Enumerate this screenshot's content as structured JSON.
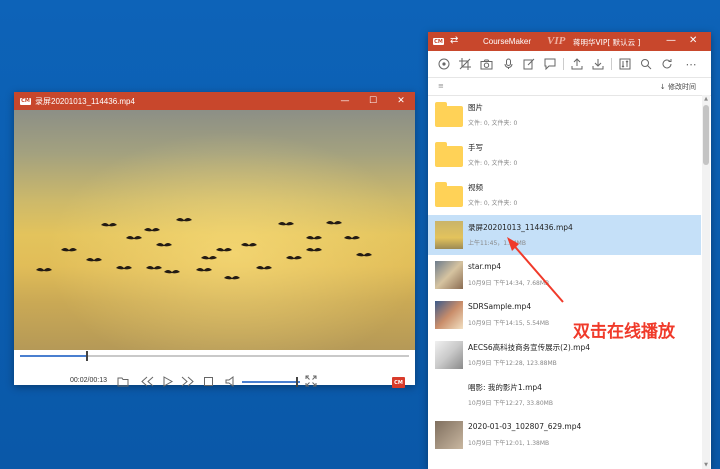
{
  "player": {
    "title": "录屏20201013_114436.mp4",
    "logo_text": "CM",
    "time": "00:02/00:13",
    "progress_fraction": 0.17,
    "volume_fraction": 0.97,
    "badge_text": "CM",
    "window_controls": [
      "minimize-icon",
      "maximize-icon",
      "close-icon"
    ],
    "control_icons": [
      "folder-icon",
      "rewind-icon",
      "play-icon",
      "fast-forward-icon",
      "stop-icon",
      "volume-icon",
      "fullscreen-icon"
    ]
  },
  "coursemaker": {
    "logo_text": "CM",
    "app_name": "CourseMaker",
    "vip": "VIP",
    "user": "蒋明华VIP[ 默认云 ]",
    "toolbar_icons": [
      "record-icon",
      "crop-icon",
      "camera-icon",
      "microphone-icon",
      "edit-icon",
      "upload-icon",
      "download-icon",
      "sort-icon",
      "search-icon",
      "refresh-icon",
      "more-icon"
    ],
    "sort_label": "↓ 修改时间",
    "items": [
      {
        "type": "folder",
        "name": "图片",
        "meta": "文件: 0, 文件夹: 0"
      },
      {
        "type": "folder",
        "name": "手写",
        "meta": "文件: 0, 文件夹: 0"
      },
      {
        "type": "folder",
        "name": "视频",
        "meta": "文件: 0, 文件夹: 0"
      },
      {
        "type": "video",
        "name": "录屏20201013_114436.mp4",
        "meta": "上午11:45，1.34MB",
        "selected": true
      },
      {
        "type": "video",
        "name": "star.mp4",
        "meta": "10月9日 下午14:34, 7.68MB"
      },
      {
        "type": "video",
        "name": "SDRSample.mp4",
        "meta": "10月9日 下午14:15, 5.54MB"
      },
      {
        "type": "video",
        "name": "AECS6高科技商务宣传展示(2).mp4",
        "meta": "10月9日 下午12:28, 123.88MB"
      },
      {
        "type": "video",
        "name": "唱影: 我的影片1.mp4",
        "meta": "10月9日 下午12:27, 33.80MB"
      },
      {
        "type": "video",
        "name": "2020-01-03_102807_629.mp4",
        "meta": "10月9日 下午12:01, 1.38MB"
      }
    ]
  },
  "annotation": {
    "text": "双击在线播放",
    "color": "#f03a2a"
  },
  "colors": {
    "titlebar": "#c8472c",
    "desktop": "#0a5cad",
    "selection": "#c5e0f8",
    "folder": "#ffd257"
  }
}
